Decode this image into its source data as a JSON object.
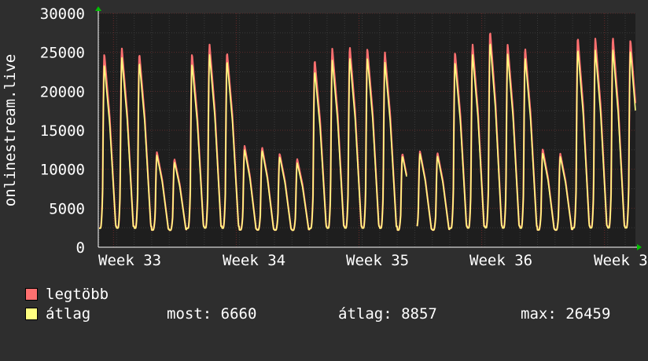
{
  "chart_data": {
    "type": "line",
    "ylabel": "onlinestream.live",
    "ylim": [
      0,
      30000
    ],
    "y_ticks": [
      "0",
      "5000",
      "10000",
      "15000",
      "20000",
      "25000",
      "30000"
    ],
    "x_tick_labels": [
      "Week 33",
      "Week 34",
      "Week 35",
      "Week 36",
      "Week 3"
    ],
    "grid": true,
    "series": [
      {
        "name": "legtöbb",
        "color": "#ff7070",
        "daily_peaks": [
          24800,
          25500,
          24800,
          12200,
          11300,
          24800,
          26000,
          25000,
          13000,
          12800,
          12000,
          11300,
          24000,
          25500,
          25700,
          25500,
          25000,
          12000,
          12300,
          12100,
          25000,
          26000,
          27700,
          26000,
          25500,
          12600,
          12000,
          26900,
          26800,
          26900,
          26600
        ],
        "daily_min": 2000
      },
      {
        "name": "átlag",
        "color": "#ffff80",
        "daily_peaks": [
          23400,
          24300,
          23700,
          11800,
          10900,
          23500,
          24700,
          23900,
          12500,
          12400,
          11600,
          10800,
          22600,
          24000,
          24300,
          24300,
          23700,
          11700,
          12000,
          11700,
          23700,
          24700,
          26300,
          24800,
          24300,
          12100,
          11600,
          25400,
          25300,
          25400,
          25200
        ],
        "daily_min": 2000
      }
    ],
    "gap": {
      "after_day": 17
    },
    "last_value": 6660
  },
  "legend": {
    "max_label": "legtöbb",
    "avg_label": "átlag",
    "max_color": "#ff7070",
    "avg_color": "#ffff80"
  },
  "stats": {
    "now": "most: 6660",
    "avg": "átlag: 8857",
    "max": "max: 26459"
  }
}
